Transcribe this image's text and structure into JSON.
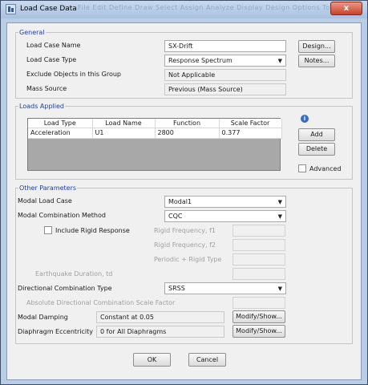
{
  "window": {
    "title": "Load Case Data",
    "ghost_menu": "File  Edit  Define  Draw  Select  Assign  Analyze  Display  Design  Options  Tools  Help",
    "close_label": "x"
  },
  "general": {
    "group_label": "General",
    "load_case_name_label": "Load Case Name",
    "load_case_name_value": "SX-Drift",
    "load_case_type_label": "Load Case Type",
    "load_case_type_value": "Response Spectrum",
    "exclude_label": "Exclude Objects in this Group",
    "exclude_value": "Not Applicable",
    "mass_source_label": "Mass Source",
    "mass_source_value": "Previous  (Mass Source)",
    "design_button": "Design...",
    "notes_button": "Notes..."
  },
  "loads_applied": {
    "group_label": "Loads Applied",
    "columns": [
      "Load Type",
      "Load Name",
      "Function",
      "Scale Factor"
    ],
    "rows": [
      [
        "Acceleration",
        "U1",
        "2800",
        "0.377"
      ]
    ],
    "add_button": "Add",
    "delete_button": "Delete",
    "advanced_label": "Advanced"
  },
  "other": {
    "group_label": "Other Parameters",
    "modal_load_case_label": "Modal Load Case",
    "modal_load_case_value": "Modal1",
    "modal_combination_label": "Modal Combination Method",
    "modal_combination_value": "CQC",
    "include_rigid_label": "Include Rigid Response",
    "rigid_f1_label": "Rigid Frequency, f1",
    "rigid_f2_label": "Rigid Frequency, f2",
    "periodic_label": "Periodic + Rigid Type",
    "earthquake_label": "Earthquake Duration, td",
    "directional_label": "Directional Combination Type",
    "directional_value": "SRSS",
    "abs_dir_label": "Absolute Directional Combination Scale Factor",
    "modal_damping_label": "Modal Damping",
    "modal_damping_value": "Constant at 0.05",
    "diaphragm_label": "Diaphragm Eccentricity",
    "diaphragm_value": "0 for All Diaphragms",
    "modify_show_button": "Modify/Show..."
  },
  "footer": {
    "ok_button": "OK",
    "cancel_button": "Cancel"
  },
  "colors": {
    "group_label": "#1f3f9a",
    "close_button": "#c9412b",
    "window_frame": "#b9cde6"
  }
}
